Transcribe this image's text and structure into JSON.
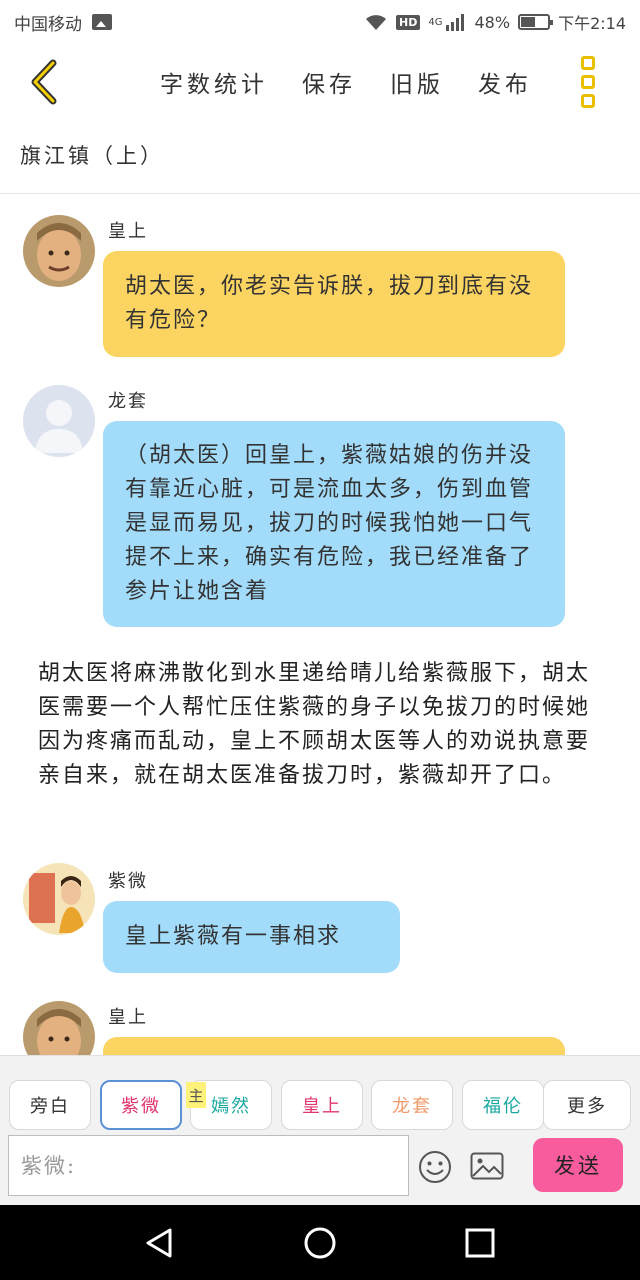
{
  "status_bar": {
    "carrier": "中国移动",
    "network": "4G",
    "battery": "48%",
    "time": "下午2:14"
  },
  "toolbar": {
    "word_count": "字数统计",
    "save": "保存",
    "old_version": "旧版",
    "publish": "发布"
  },
  "story": {
    "title": "旗江镇（上）"
  },
  "messages": [
    {
      "speaker": "皇上",
      "text": "胡太医，你老实告诉朕，拔刀到底有没有危险？",
      "color": "#fcd462"
    },
    {
      "speaker": "龙套",
      "text": "（胡太医）回皇上，紫薇姑娘的伤并没有靠近心脏，可是流血太多，伤到血管是显而易见，拔刀的时候我怕她一口气提不上来，确实有危险，我已经准备了参片让她含着",
      "color": "#a3dcfa"
    },
    {
      "speaker": "紫微",
      "text": "皇上紫薇有一事相求",
      "color": "#a3dcfa"
    },
    {
      "speaker": "皇上",
      "text": "",
      "color": "#fcd462"
    }
  ],
  "narration": "胡太医将麻沸散化到水里递给晴儿给紫薇服下，胡太医需要一个人帮忙压住紫薇的身子以免拔刀的时候她因为疼痛而乱动，皇上不顾胡太医等人的劝说执意要亲自来，就在胡太医准备拔刀时，紫薇却开了口。",
  "roles": [
    {
      "label": "旁白",
      "color": "#333333"
    },
    {
      "label": "紫微",
      "color": "#e0356f"
    },
    {
      "label": "嫣然",
      "color": "#1aa7a0"
    },
    {
      "label": "皇上",
      "color": "#e0356f"
    },
    {
      "label": "龙套",
      "color": "#f39a6b"
    },
    {
      "label": "福伦",
      "color": "#1aa7a0"
    },
    {
      "label": "更多",
      "color": "#333333"
    }
  ],
  "master_tag": "主",
  "input": {
    "placeholder": "紫微:"
  },
  "send_label": "发送"
}
